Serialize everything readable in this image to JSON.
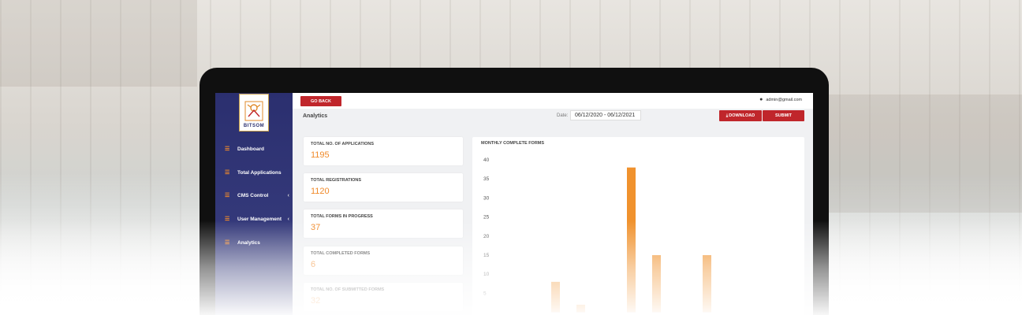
{
  "app": {
    "brand": "BITSOM"
  },
  "sidebar": {
    "items": [
      {
        "label": "Dashboard",
        "has_chevron": false
      },
      {
        "label": "Total Applications",
        "has_chevron": false
      },
      {
        "label": "CMS Control",
        "has_chevron": true
      },
      {
        "label": "User Management",
        "has_chevron": true
      },
      {
        "label": "Analytics",
        "has_chevron": false
      }
    ]
  },
  "header": {
    "go_back_label": "GO BACK",
    "user_email": "admin@gmail.com",
    "page_title": "Analytics",
    "date_label": "Date:",
    "date_range": "06/12/2020 - 06/12/2021",
    "download_label": "DOWNLOAD",
    "submit_label": "SUBMIT"
  },
  "stats": [
    {
      "label": "TOTAL NO. OF APPLICATIONS",
      "value": "1195"
    },
    {
      "label": "TOTAL REGISTRATIONS",
      "value": "1120"
    },
    {
      "label": "TOTAL FORMS IN PROGRESS",
      "value": "37"
    },
    {
      "label": "TOTAL COMPLETED FORMS",
      "value": "6"
    },
    {
      "label": "TOTAL NO. OF SUBMITTED FORMS",
      "value": "32"
    }
  ],
  "chart_data": {
    "type": "bar",
    "title": "MONTHLY COMPLETE FORMS",
    "yticks": [
      40,
      35,
      30,
      25,
      20,
      15,
      10,
      5
    ],
    "ylim": [
      0,
      40
    ],
    "values": [
      8,
      2,
      38,
      15,
      15
    ],
    "color": "#f0922e",
    "grid": false
  },
  "colors": {
    "accent": "#f08a2a",
    "brand_red": "#c0262b",
    "sidebar": "#2b2f6f"
  }
}
